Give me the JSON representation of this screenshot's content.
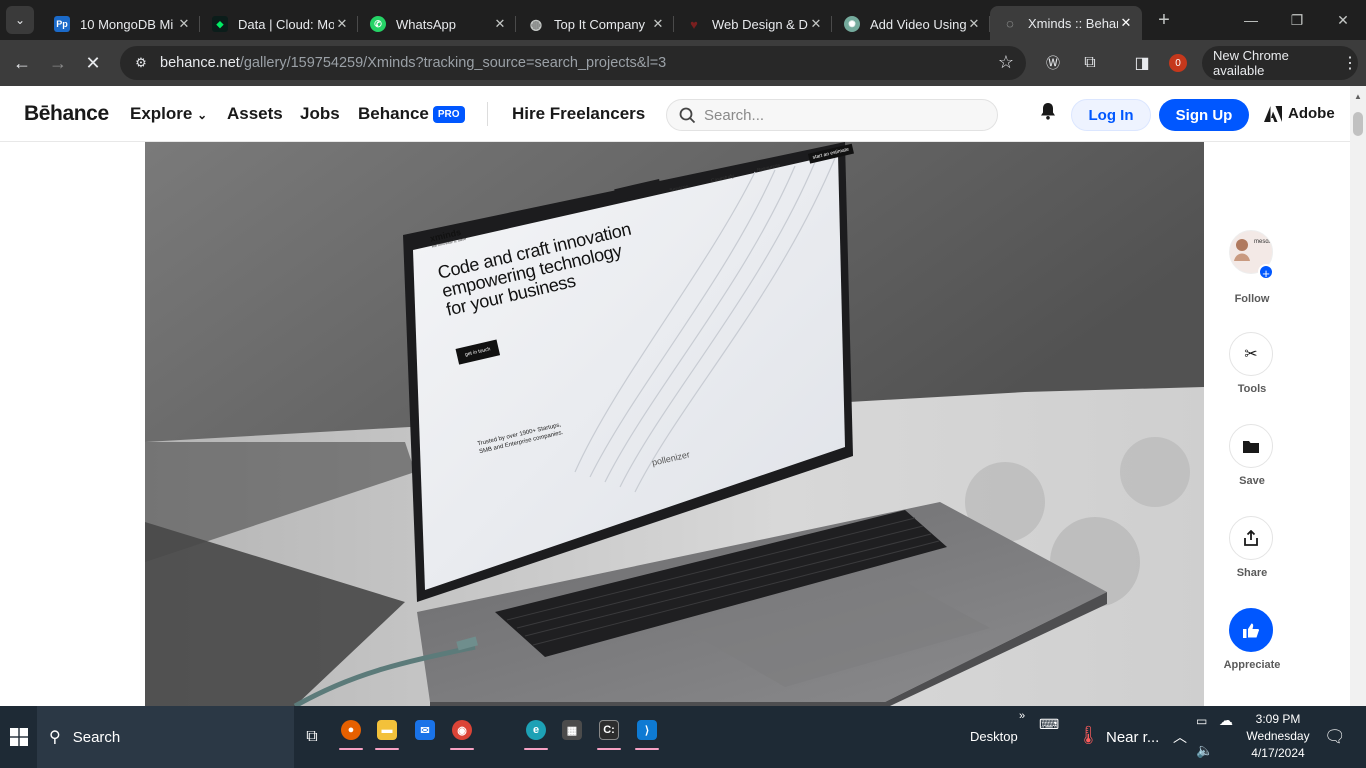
{
  "browser": {
    "tabs": [
      {
        "title": "10 MongoDB Mi",
        "favicon": "Pp",
        "favicon_color": "#1b6ac9"
      },
      {
        "title": "Data | Cloud: Mo",
        "favicon": "leaf",
        "favicon_color": "#00684a"
      },
      {
        "title": "WhatsApp",
        "favicon": "whatsapp",
        "favicon_color": "#25d366"
      },
      {
        "title": "Top It Company",
        "favicon": "globe",
        "favicon_color": "#9aa0a6"
      },
      {
        "title": "Web Design & D",
        "favicon": "heart",
        "favicon_color": "#7a1f1f"
      },
      {
        "title": "Add Video Using",
        "favicon": "chatgpt",
        "favicon_color": "#74aa9c"
      },
      {
        "title": "Xminds :: Behanc",
        "favicon": "loading",
        "favicon_color": "#9aa0a6",
        "active": true
      }
    ],
    "url_host": "behance.net",
    "url_path": "/gallery/159754259/Xminds?tracking_source=search_projects&l=3",
    "extension_badge": "0",
    "new_chrome_label": "New Chrome available"
  },
  "behance": {
    "logo": "Bēhance",
    "nav": {
      "explore": "Explore",
      "assets": "Assets",
      "jobs": "Jobs",
      "behance": "Behance",
      "pro_badge": "PRO",
      "hire": "Hire Freelancers"
    },
    "search_placeholder": "Search...",
    "login": "Log In",
    "signup": "Sign Up",
    "adobe": "Adobe",
    "brand_color": "#0057ff"
  },
  "hero": {
    "screen_brand": "xminds",
    "screen_tagline": "we innovate it, save",
    "screen_headline_1": "Code and craft innovation",
    "screen_headline_2": "empowering technology",
    "screen_headline_3": "for your business",
    "screen_cta": "get in touch",
    "screen_nav_1": "Services",
    "screen_nav_2": "Casestudy",
    "screen_nav_3": "Resources",
    "screen_nav_cta": "start an estimate",
    "screen_trust_1": "Trusted by over 1900+ Startups,",
    "screen_trust_2": "SMB and Enterprise companies.",
    "screen_client": "pollenizer"
  },
  "rail": {
    "avatar_text": "mesda",
    "follow": "Follow",
    "tools": "Tools",
    "save": "Save",
    "share": "Share",
    "appreciate": "Appreciate"
  },
  "taskbar": {
    "search": "Search",
    "desktop": "Desktop",
    "weather": "Near r...",
    "time": "3:09 PM",
    "day": "Wednesday",
    "date": "4/17/2024",
    "apps": [
      "firefox",
      "file-explorer",
      "mail",
      "chrome",
      "edge",
      "store",
      "terminal",
      "vscode"
    ]
  }
}
